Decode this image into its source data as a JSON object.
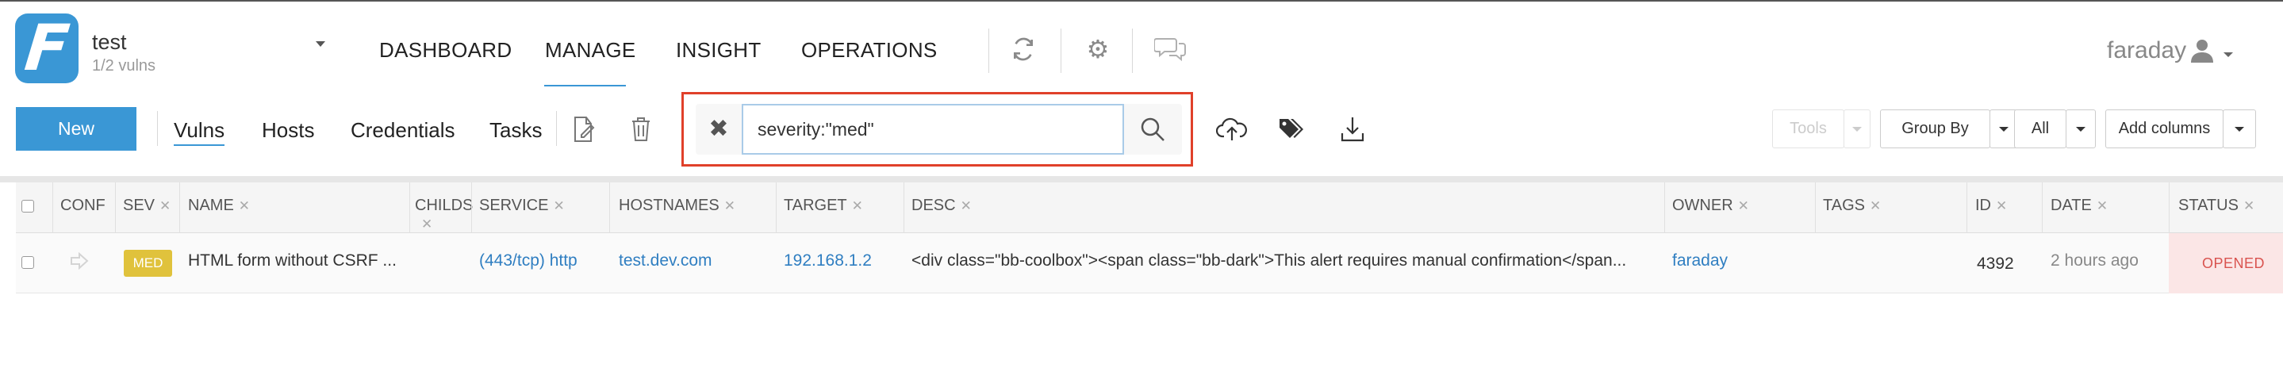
{
  "header": {
    "logo_letter": "F",
    "workspace": {
      "name": "test",
      "vulns": "1/2 vulns"
    },
    "nav": [
      {
        "label": "DASHBOARD"
      },
      {
        "label": "MANAGE",
        "active": true
      },
      {
        "label": "INSIGHT"
      },
      {
        "label": "OPERATIONS"
      }
    ],
    "user": "faraday"
  },
  "toolbar": {
    "new_label": "New",
    "tabs": [
      {
        "label": "Vulns",
        "active": true
      },
      {
        "label": "Hosts"
      },
      {
        "label": "Credentials"
      },
      {
        "label": "Tasks"
      }
    ],
    "search": {
      "value": "severity:\"med\""
    },
    "tools_label": "Tools",
    "group_by_label": "Group By",
    "all_label": "All",
    "add_columns_label": "Add columns"
  },
  "table": {
    "columns": [
      "CONF",
      "SEV",
      "NAME",
      "CHILDS",
      "SERVICE",
      "HOSTNAMES",
      "TARGET",
      "DESC",
      "OWNER",
      "TAGS",
      "ID",
      "DATE",
      "STATUS"
    ],
    "rows": [
      {
        "sev": "MED",
        "name": "HTML form without CSRF ...",
        "service": "(443/tcp) http",
        "hostnames": "test.dev.com",
        "target": "192.168.1.2",
        "desc": "<div class=\"bb-coolbox\"><span class=\"bb-dark\">This alert requires manual confirmation</span...",
        "owner": "faraday",
        "id": "4392",
        "date": "2 hours ago",
        "status": "OPENED"
      }
    ]
  },
  "colors": {
    "primary": "#3a97d5",
    "search_highlight": "#e0402a",
    "sev_med": "#e0c23c",
    "status_opened": "#d9534f"
  }
}
